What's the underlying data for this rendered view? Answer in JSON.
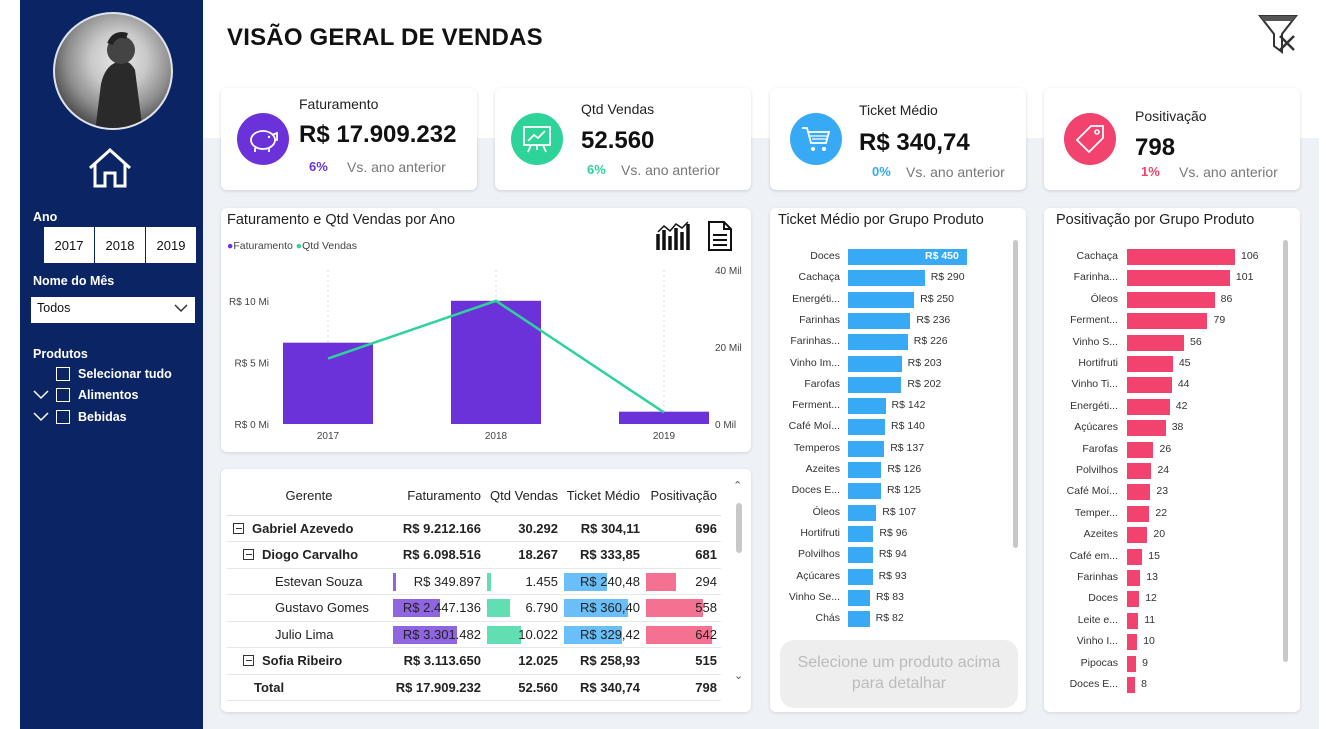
{
  "sidebar": {
    "ano_label": "Ano",
    "years": [
      "2017",
      "2018",
      "2019"
    ],
    "mes_label": "Nome do Mês",
    "mes_value": "Todos",
    "produtos_label": "Produtos",
    "tree": [
      "Selecionar tudo",
      "Alimentos",
      "Bebidas"
    ]
  },
  "page_title": "VISÃO GERAL DE VENDAS",
  "kpis": [
    {
      "label": "Faturamento",
      "value": "R$ 17.909.232",
      "pct": "6%",
      "sub": "Vs. ano anterior",
      "color": "#6a32d8"
    },
    {
      "label": "Qtd Vendas",
      "value": "52.560",
      "pct": "6%",
      "sub": "Vs. ano anterior",
      "color": "#2ed39a"
    },
    {
      "label": "Ticket Médio",
      "value": "R$ 340,74",
      "pct": "0%",
      "sub": "Vs. ano anterior",
      "color": "#38aaf5"
    },
    {
      "label": "Positivação",
      "value": "798",
      "pct": "1%",
      "sub": "Vs. ano anterior",
      "color": "#f2426e"
    }
  ],
  "chart_data": {
    "type": "bar",
    "title": "Faturamento e Qtd Vendas por Ano",
    "categories": [
      "2017",
      "2018",
      "2019"
    ],
    "series": [
      {
        "name": "Faturamento",
        "type": "bar",
        "values": [
          6.6,
          10.0,
          1.0
        ],
        "color": "#6a32d8"
      },
      {
        "name": "Qtd Vendas",
        "type": "line",
        "values": [
          17000,
          32000,
          3000
        ],
        "color": "#2ed39a"
      }
    ],
    "y_left_ticks": [
      "R$ 0 Mi",
      "R$ 5 Mi",
      "R$ 10 Mi"
    ],
    "y_left_range": [
      0,
      12.5
    ],
    "y_right_ticks": [
      "0 Mil",
      "20 Mil",
      "40 Mil"
    ],
    "y_right_range": [
      0,
      40000
    ]
  },
  "table": {
    "headers": [
      "Gerente",
      "Faturamento",
      "Qtd Vendas",
      "Ticket Médio",
      "Positivação"
    ],
    "rows": [
      {
        "level": 0,
        "expand": true,
        "name": "Gabriel Azevedo",
        "fat": "R$ 9.212.166",
        "qtd": "30.292",
        "tic": "R$ 304,11",
        "pos": "696"
      },
      {
        "level": 1,
        "expand": true,
        "name": "Diogo Carvalho",
        "fat": "R$ 6.098.516",
        "qtd": "18.267",
        "tic": "R$ 333,85",
        "pos": "681"
      },
      {
        "level": 2,
        "name": "Estevan Souza",
        "fat": "R$ 349.897",
        "qtd": "1.455",
        "tic": "R$ 240,48",
        "pos": "294",
        "f": 0.03,
        "q": 0.1,
        "t": 0.58,
        "p": 0.46
      },
      {
        "level": 2,
        "name": "Gustavo Gomes",
        "fat": "R$ 2.447.136",
        "qtd": "6.790",
        "tic": "R$ 360,40",
        "pos": "558",
        "f": 0.55,
        "q": 0.6,
        "t": 0.86,
        "p": 0.87
      },
      {
        "level": 2,
        "name": "Julio Lima",
        "fat": "R$ 3.301.482",
        "qtd": "10.022",
        "tic": "R$ 329,42",
        "pos": "642",
        "f": 0.74,
        "q": 0.9,
        "t": 0.79,
        "p": 1.0
      },
      {
        "level": 1,
        "expand": true,
        "name": "Sofia Ribeiro",
        "fat": "R$ 3.113.650",
        "qtd": "12.025",
        "tic": "R$ 258,93",
        "pos": "515"
      },
      {
        "level": -1,
        "name": "Total",
        "fat": "R$ 17.909.232",
        "qtd": "52.560",
        "tic": "R$ 340,74",
        "pos": "798"
      }
    ]
  },
  "ticket": {
    "title": "Ticket Médio por Grupo Produto",
    "prompt": "Selecione um produto acima para detalhar",
    "items": [
      [
        "Doces",
        450,
        "R$ 450"
      ],
      [
        "Cachaça",
        290,
        "R$ 290"
      ],
      [
        "Energéti...",
        250,
        "R$ 250"
      ],
      [
        "Farinhas",
        236,
        "R$ 236"
      ],
      [
        "Farinhas...",
        226,
        "R$ 226"
      ],
      [
        "Vinho Im...",
        203,
        "R$ 203"
      ],
      [
        "Farofas",
        202,
        "R$ 202"
      ],
      [
        "Ferment...",
        142,
        "R$ 142"
      ],
      [
        "Café Moí...",
        140,
        "R$ 140"
      ],
      [
        "Temperos",
        137,
        "R$ 137"
      ],
      [
        "Azeites",
        126,
        "R$ 126"
      ],
      [
        "Doces E...",
        125,
        "R$ 125"
      ],
      [
        "Óleos",
        107,
        "R$ 107"
      ],
      [
        "Hortifruti",
        96,
        "R$ 96"
      ],
      [
        "Polvilhos",
        94,
        "R$ 94"
      ],
      [
        "Açúcares",
        93,
        "R$ 93"
      ],
      [
        "Vinho Se...",
        83,
        "R$ 83"
      ],
      [
        "Chás",
        82,
        "R$ 82"
      ]
    ]
  },
  "posit": {
    "title": "Positivação por Grupo Produto",
    "items": [
      [
        "Cachaça",
        106
      ],
      [
        "Farinha...",
        101
      ],
      [
        "Óleos",
        86
      ],
      [
        "Ferment...",
        79
      ],
      [
        "Vinho S...",
        56
      ],
      [
        "Hortifruti",
        45
      ],
      [
        "Vinho Ti...",
        44
      ],
      [
        "Energéti...",
        42
      ],
      [
        "Açúcares",
        38
      ],
      [
        "Farofas",
        26
      ],
      [
        "Polvilhos",
        24
      ],
      [
        "Café Moí...",
        23
      ],
      [
        "Temper...",
        22
      ],
      [
        "Azeites",
        20
      ],
      [
        "Café em...",
        15
      ],
      [
        "Farinhas",
        13
      ],
      [
        "Doces",
        12
      ],
      [
        "Leite e...",
        11
      ],
      [
        "Vinho I...",
        10
      ],
      [
        "Pipocas",
        9
      ],
      [
        "Doces E...",
        8
      ]
    ]
  }
}
